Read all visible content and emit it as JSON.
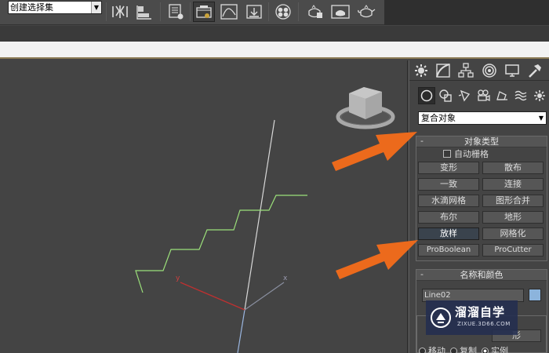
{
  "toolbar": {
    "selection_set": "创建选择集",
    "icons": [
      "mirror-icon",
      "align-icon",
      "layer-manager-icon",
      "scene-explorer-icon",
      "curve-editor-icon",
      "schematic-view-icon",
      "material-editor-icon",
      "render-setup-icon",
      "rendered-frame-icon",
      "render-teapot-icon"
    ]
  },
  "viewport": {
    "axis_x": "x",
    "axis_y": "y",
    "object_color": "#9be07a"
  },
  "command_panel": {
    "tabs": [
      "create-tab",
      "modify-tab",
      "hierarchy-tab",
      "motion-tab",
      "display-tab",
      "utilities-tab"
    ],
    "categories": [
      "geometry",
      "shapes",
      "lights",
      "cameras",
      "helpers",
      "space-warps",
      "systems"
    ],
    "category_dropdown": "复合对象",
    "object_type": {
      "title": "对象类型",
      "minus": "-",
      "autogrid_label": "自动栅格",
      "buttons": [
        "变形",
        "散布",
        "一致",
        "连接",
        "水滴网格",
        "图形合并",
        "布尔",
        "地形",
        "放样",
        "网格化",
        "ProBoolean",
        "ProCutter"
      ],
      "active_button": "放样"
    },
    "name_color": {
      "title": "名称和颜色",
      "minus": "-",
      "name": "Line02",
      "color": "#8cb4dc"
    },
    "creation": {
      "shape_button": "形",
      "radios": [
        "移动",
        "复制",
        "实例"
      ],
      "selected": "实例"
    }
  },
  "watermark": {
    "title": "溜溜自学",
    "subtitle": "ZIXUE.3D66.COM"
  },
  "arrow_color": "#ec6a1c"
}
